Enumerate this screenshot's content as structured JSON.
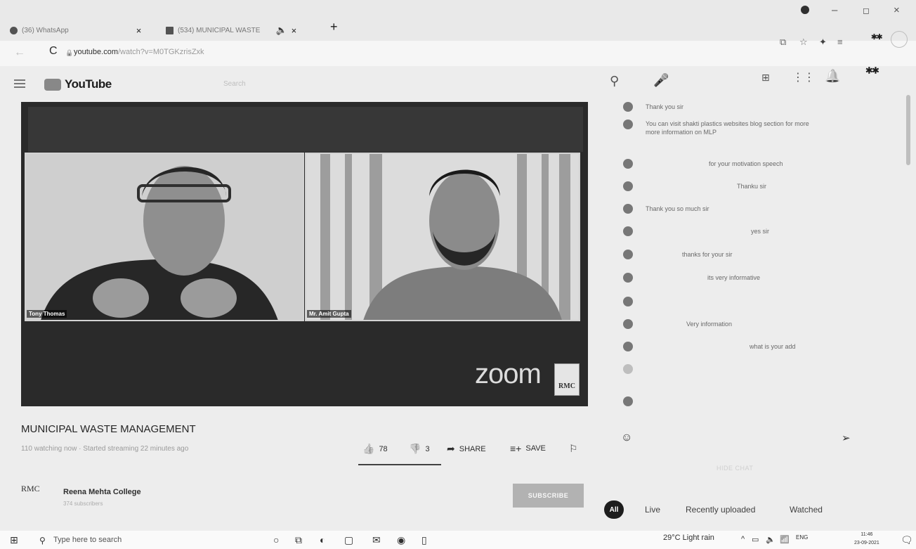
{
  "browser": {
    "tabs": [
      {
        "label": "(36) WhatsApp"
      },
      {
        "label": "(534) MUNICIPAL WASTE"
      }
    ],
    "tab_close": "×",
    "new_tab": "+",
    "url_domain": "youtube.com",
    "url_path": "/watch?v=M0TGKzrisZxk",
    "window_controls": {
      "minimize": "–",
      "maximize": "◻",
      "close": "×"
    }
  },
  "youtube": {
    "logo_text": "YouTube",
    "search_placeholder": "Search"
  },
  "player": {
    "participants": [
      {
        "name": "Tony Thomas"
      },
      {
        "name": "Mr. Amit Gupta"
      }
    ],
    "watermark": "zoom",
    "channel_badge": "RMC"
  },
  "video": {
    "title": "MUNICIPAL WASTE MANAGEMENT",
    "meta": "110 watching now · Started streaming 22 minutes ago",
    "likes": "78",
    "dislikes": "3",
    "share_label": "SHARE",
    "save_label": "SAVE"
  },
  "channel": {
    "logo_text": "RMC",
    "name": "Reena Mehta College",
    "subscribers": "374 subscribers",
    "subscribe_label": "SUBSCRIBE"
  },
  "chat": {
    "messages": [
      {
        "author": "",
        "text": "Thank you sir"
      },
      {
        "author": "",
        "text": "You can visit shakti plastics websites blog section for more more information on MLP"
      },
      {
        "author": "",
        "text": "for your motivation speech"
      },
      {
        "author": "",
        "text": "Thanku sir"
      },
      {
        "author": "",
        "text": "Thank you so much sir"
      },
      {
        "author": "",
        "text": "yes sir"
      },
      {
        "author": "",
        "text": "thanks for your sir"
      },
      {
        "author": "",
        "text": "its very informative"
      },
      {
        "author": "",
        "text": ""
      },
      {
        "author": "",
        "text": "Very information"
      },
      {
        "author": "",
        "text": "what is your add"
      },
      {
        "author": "",
        "text": ""
      },
      {
        "author": "",
        "text": ""
      }
    ],
    "hide_chat": "HIDE CHAT"
  },
  "chips": {
    "items": [
      "All",
      "Live",
      "Recently uploaded",
      "Watched"
    ]
  },
  "taskbar": {
    "search_placeholder": "Type here to search",
    "weather": "29°C  Light rain",
    "lang": "ENG",
    "time": "11:46",
    "date": "23-09-2021"
  }
}
